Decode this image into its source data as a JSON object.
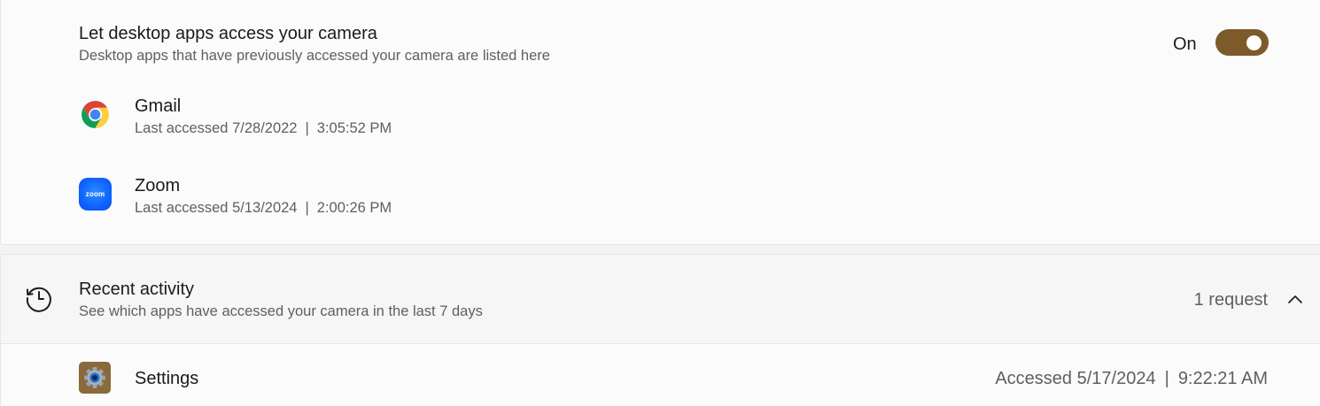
{
  "desktop_access": {
    "title": "Let desktop apps access your camera",
    "description": "Desktop apps that have previously accessed your camera are listed here",
    "toggle_state": "On",
    "toggle_on": true,
    "toggle_color": "#7d5a29",
    "apps": [
      {
        "name": "Gmail",
        "icon": "chrome-icon",
        "accessed_prefix": "Last accessed",
        "date": "7/28/2022",
        "time": "3:05:52 PM"
      },
      {
        "name": "Zoom",
        "icon": "zoom-icon",
        "icon_text": "zoom",
        "accessed_prefix": "Last accessed",
        "date": "5/13/2024",
        "time": "2:00:26 PM"
      }
    ]
  },
  "recent_activity": {
    "icon": "history-icon",
    "title": "Recent activity",
    "description": "See which apps have accessed your camera in the last 7 days",
    "count": "1 request",
    "expanded": true,
    "items": [
      {
        "name": "Settings",
        "icon": "settings-gear-icon",
        "accessed_prefix": "Accessed",
        "date": "5/17/2024",
        "time": "9:22:21 AM"
      }
    ]
  },
  "separator": "|"
}
